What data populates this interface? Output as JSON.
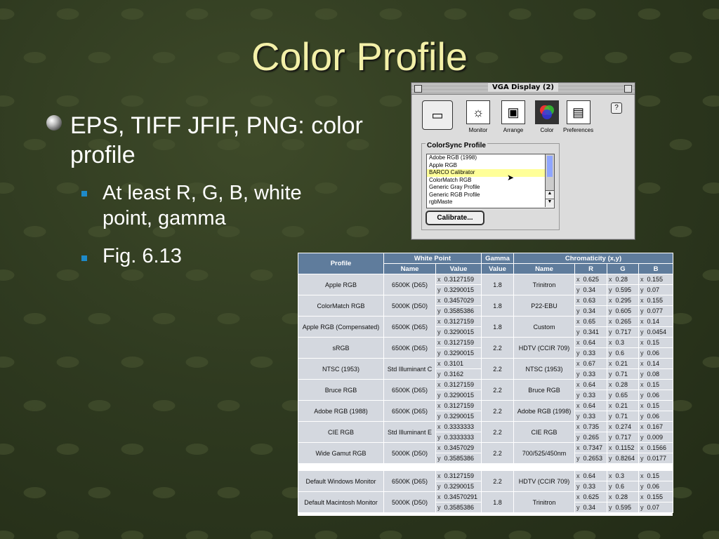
{
  "slide": {
    "title": "Color Profile",
    "bullet1": "EPS, TIFF JFIF, PNG: color profile",
    "sub_bullets": [
      "At least R, G, B, white point, gamma",
      "Fig. 6.13"
    ]
  },
  "window": {
    "title": "VGA Display (2)",
    "tools": [
      {
        "label": "Monitor",
        "icon": "monitor-icon"
      },
      {
        "label": "Arrange",
        "icon": "arrange-icon"
      },
      {
        "label": "Color",
        "icon": "color-icon"
      },
      {
        "label": "Preferences",
        "icon": "preferences-icon"
      }
    ],
    "group_label": "ColorSync Profile",
    "profiles": [
      "Adobe RGB (1998)",
      "Apple RGB",
      "BARCO Calibrator",
      "ColorMatch RGB",
      "Generic Gray Profile",
      "Generic RGB Profile",
      "rgbMaste"
    ],
    "selected_profile": "BARCO Calibrator",
    "calibrate_label": "Calibrate..."
  },
  "table": {
    "headers": {
      "profile": "Profile",
      "white_point": "White Point",
      "gamma": "Gamma",
      "gamma2": "Value",
      "chromaticity": "Chromaticity (x,y)",
      "name": "Name",
      "value": "Value",
      "r": "R",
      "g": "G",
      "b": "B"
    },
    "rows": [
      {
        "profile": "Apple RGB",
        "wp_name": "6500K (D65)",
        "wp_x": "0.3127159",
        "wp_y": "0.3290015",
        "gamma": "1.8",
        "name": "Trinitron",
        "r": [
          "0.625",
          "0.34"
        ],
        "g": [
          "0.28",
          "0.595"
        ],
        "b": [
          "0.155",
          "0.07"
        ]
      },
      {
        "profile": "ColorMatch RGB",
        "wp_name": "5000K (D50)",
        "wp_x": "0.3457029",
        "wp_y": "0.3585386",
        "gamma": "1.8",
        "name": "P22-EBU",
        "r": [
          "0.63",
          "0.34"
        ],
        "g": [
          "0.295",
          "0.605"
        ],
        "b": [
          "0.155",
          "0.077"
        ]
      },
      {
        "profile": "Apple RGB (Compensated)",
        "wp_name": "6500K (D65)",
        "wp_x": "0.3127159",
        "wp_y": "0.3290015",
        "gamma": "1.8",
        "name": "Custom",
        "r": [
          "0.65",
          "0.341"
        ],
        "g": [
          "0.265",
          "0.717"
        ],
        "b": [
          "0.14",
          "0.0454"
        ]
      },
      {
        "profile": "sRGB",
        "wp_name": "6500K (D65)",
        "wp_x": "0.3127159",
        "wp_y": "0.3290015",
        "gamma": "2.2",
        "name": "HDTV (CCIR 709)",
        "r": [
          "0.64",
          "0.33"
        ],
        "g": [
          "0.3",
          "0.6"
        ],
        "b": [
          "0.15",
          "0.06"
        ]
      },
      {
        "profile": "NTSC (1953)",
        "wp_name": "Std Illuminant C",
        "wp_x": "0.3101",
        "wp_y": "0.3162",
        "gamma": "2.2",
        "name": "NTSC (1953)",
        "r": [
          "0.67",
          "0.33"
        ],
        "g": [
          "0.21",
          "0.71"
        ],
        "b": [
          "0.14",
          "0.08"
        ]
      },
      {
        "profile": "Bruce RGB",
        "wp_name": "6500K (D65)",
        "wp_x": "0.3127159",
        "wp_y": "0.3290015",
        "gamma": "2.2",
        "name": "Bruce RGB",
        "r": [
          "0.64",
          "0.33"
        ],
        "g": [
          "0.28",
          "0.65"
        ],
        "b": [
          "0.15",
          "0.06"
        ]
      },
      {
        "profile": "Adobe RGB (1988)",
        "wp_name": "6500K (D65)",
        "wp_x": "0.3127159",
        "wp_y": "0.3290015",
        "gamma": "2.2",
        "name": "Adobe RGB (1998)",
        "r": [
          "0.64",
          "0.33"
        ],
        "g": [
          "0.21",
          "0.71"
        ],
        "b": [
          "0.15",
          "0.06"
        ]
      },
      {
        "profile": "CIE RGB",
        "wp_name": "Std Illuminant E",
        "wp_x": "0.3333333",
        "wp_y": "0.3333333",
        "gamma": "2.2",
        "name": "CIE RGB",
        "r": [
          "0.735",
          "0.265"
        ],
        "g": [
          "0.274",
          "0.717"
        ],
        "b": [
          "0.167",
          "0.009"
        ]
      },
      {
        "profile": "Wide Gamut RGB",
        "wp_name": "5000K (D50)",
        "wp_x": "0.3457029",
        "wp_y": "0.3585386",
        "gamma": "2.2",
        "name": "700/525/450nm",
        "r": [
          "0.7347",
          "0.2653"
        ],
        "g": [
          "0.1152",
          "0.8264"
        ],
        "b": [
          "0.1566",
          "0.0177"
        ]
      },
      {
        "profile": "Default Windows Monitor",
        "wp_name": "6500K (D65)",
        "wp_x": "0.3127159",
        "wp_y": "0.3290015",
        "gamma": "2.2",
        "name": "HDTV (CCIR 709)",
        "r": [
          "0.64",
          "0.33"
        ],
        "g": [
          "0.3",
          "0.6"
        ],
        "b": [
          "0.15",
          "0.06"
        ]
      },
      {
        "profile": "Default Macintosh Monitor",
        "wp_name": "5000K (D50)",
        "wp_x": "0.34570291",
        "wp_y": "0.3585386",
        "gamma": "1.8",
        "name": "Trinitron",
        "r": [
          "0.625",
          "0.34"
        ],
        "g": [
          "0.28",
          "0.595"
        ],
        "b": [
          "0.155",
          "0.07"
        ]
      }
    ]
  }
}
